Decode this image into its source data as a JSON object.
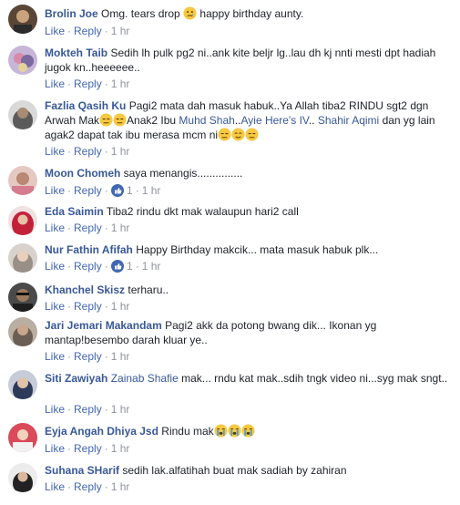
{
  "actions": {
    "like": "Like",
    "reply": "Reply",
    "dot": "·"
  },
  "comments": [
    {
      "name": "Brolin Joe",
      "text": "Omg. tears drop",
      "text2": "happy birthday aunty.",
      "reactions": "",
      "time": "1 hr"
    },
    {
      "name": "Mokteh Taib",
      "text": "Sedih lh pulk pg2 ni..ank kite beljr lg..lau dh kj nnti mesti dpt hadiah jugok kn..heeeeee..",
      "reactions": "",
      "time": "1 hr"
    },
    {
      "name": "Fazlia Qasih Ku",
      "text": "Pagi2 mata dah masuk habuk..Ya Allah tiba2 RINDU sgt2 dgn Arwah Mak",
      "text2": "Anak2 Ibu",
      "mention1": "Muhd Shah",
      "sep1": "..",
      "mention2": "Ayie Here's IV",
      "sep2": "..",
      "mention3": "Shahir Aqimi",
      "text3": "dan yg lain agak2 dapat tak ibu merasa mcm ni",
      "reactions": "",
      "time": "1 hr"
    },
    {
      "name": "Moon Chomeh",
      "text": "saya menangis...............",
      "reactions": "1",
      "time": "1 hr"
    },
    {
      "name": "Eda Saimin",
      "text": "Tiba2 rindu dkt mak walaupun hari2 call",
      "reactions": "",
      "time": "1 hr"
    },
    {
      "name": "Nur Fathin Afifah",
      "text": "Happy Birthday makcik... mata masuk habuk plk...",
      "reactions": "1",
      "time": "1 hr"
    },
    {
      "name": "Khanchel Skisz",
      "text": "terharu..",
      "reactions": "",
      "time": "1 hr"
    },
    {
      "name": "Jari Jemari Makandam",
      "text": "Pagi2 akk da potong bwang dik... Ikonan yg mantap!besembo darah kluar ye..",
      "reactions": "",
      "time": "1 hr"
    },
    {
      "name": "Siti Zawiyah",
      "mention1": "Zainab Shafie",
      "text": "mak... rndu kat mak..sdih tngk video ni...syg mak sngt..",
      "reactions": "",
      "time": "1 hr"
    },
    {
      "name": "Eyja Angah Dhiya Jsd",
      "text": "Rindu mak",
      "reactions": "",
      "time": "1 hr"
    },
    {
      "name": "Suhana SHarif",
      "text": "sedih lak.alfatihah buat mak sadiah by zahiran",
      "reactions": "",
      "time": "1 hr"
    }
  ],
  "colors": {
    "link": "#385898",
    "meta": "#90949c",
    "like_blue": "#4267b2"
  }
}
